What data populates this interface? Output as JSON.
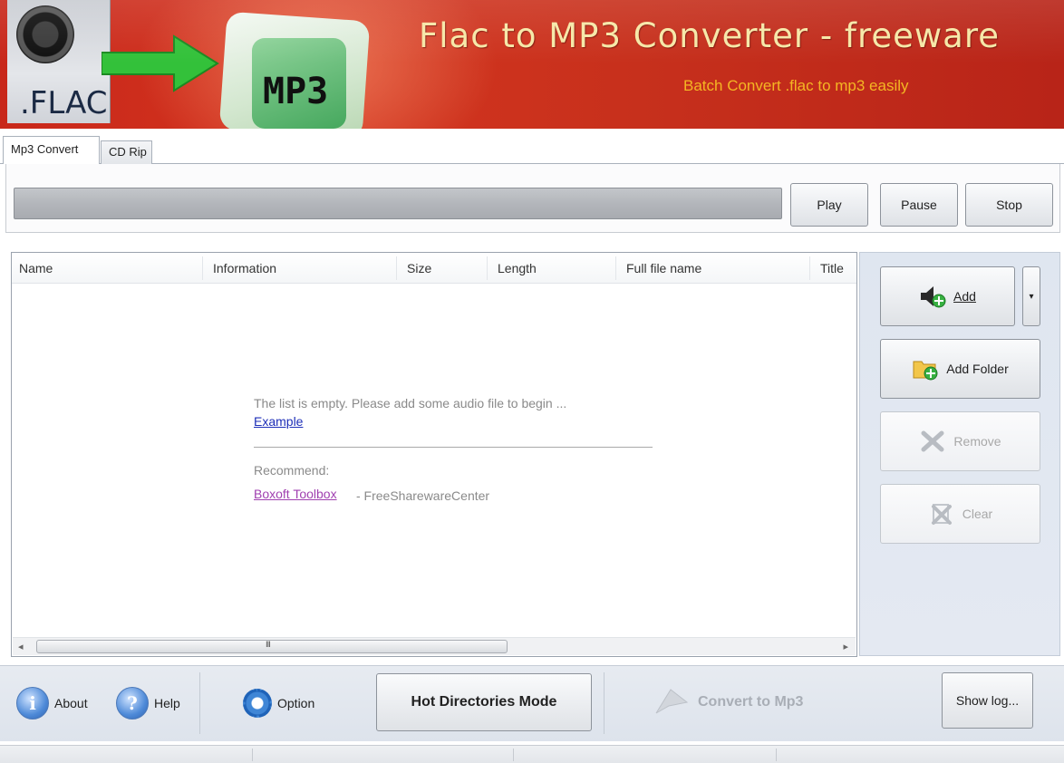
{
  "banner": {
    "flac_label": ".FLAC",
    "mp3_label": "MP3",
    "title": "Flac to MP3 Converter - freeware",
    "subtitle": "Batch Convert  .flac to mp3 easily"
  },
  "tabs": [
    {
      "label": "Mp3 Convert",
      "active": true
    },
    {
      "label": "CD Rip",
      "active": false
    }
  ],
  "player": {
    "progress": 0,
    "play_label": "Play",
    "pause_label": "Pause",
    "stop_label": "Stop"
  },
  "list": {
    "columns": [
      "Name",
      "Information",
      "Size",
      "Length",
      "Full file name",
      "Title"
    ],
    "empty_message": "The list is empty. Please add some audio file to begin ...",
    "example_link": "Example",
    "recommend_label": "Recommend:",
    "recommend_link": "Boxoft Toolbox",
    "recommend_suffix": "- FreeSharewareCenter",
    "scroll_grip": "III"
  },
  "actions": {
    "add_label": "Add",
    "add_folder_label": "Add Folder",
    "remove_label": "Remove",
    "clear_label": "Clear"
  },
  "bottom": {
    "about_label": "About",
    "help_label": "Help",
    "option_label": "Option",
    "hot_dirs_label": "Hot Directories Mode",
    "convert_label": "Convert to Mp3",
    "show_log_label": "Show log..."
  },
  "colors": {
    "banner_red": "#c8271a",
    "title_yellow": "#f6e7a6",
    "subtitle_orange": "#f4b623",
    "link_blue": "#1e2fb8",
    "link_purple": "#a040b0"
  }
}
